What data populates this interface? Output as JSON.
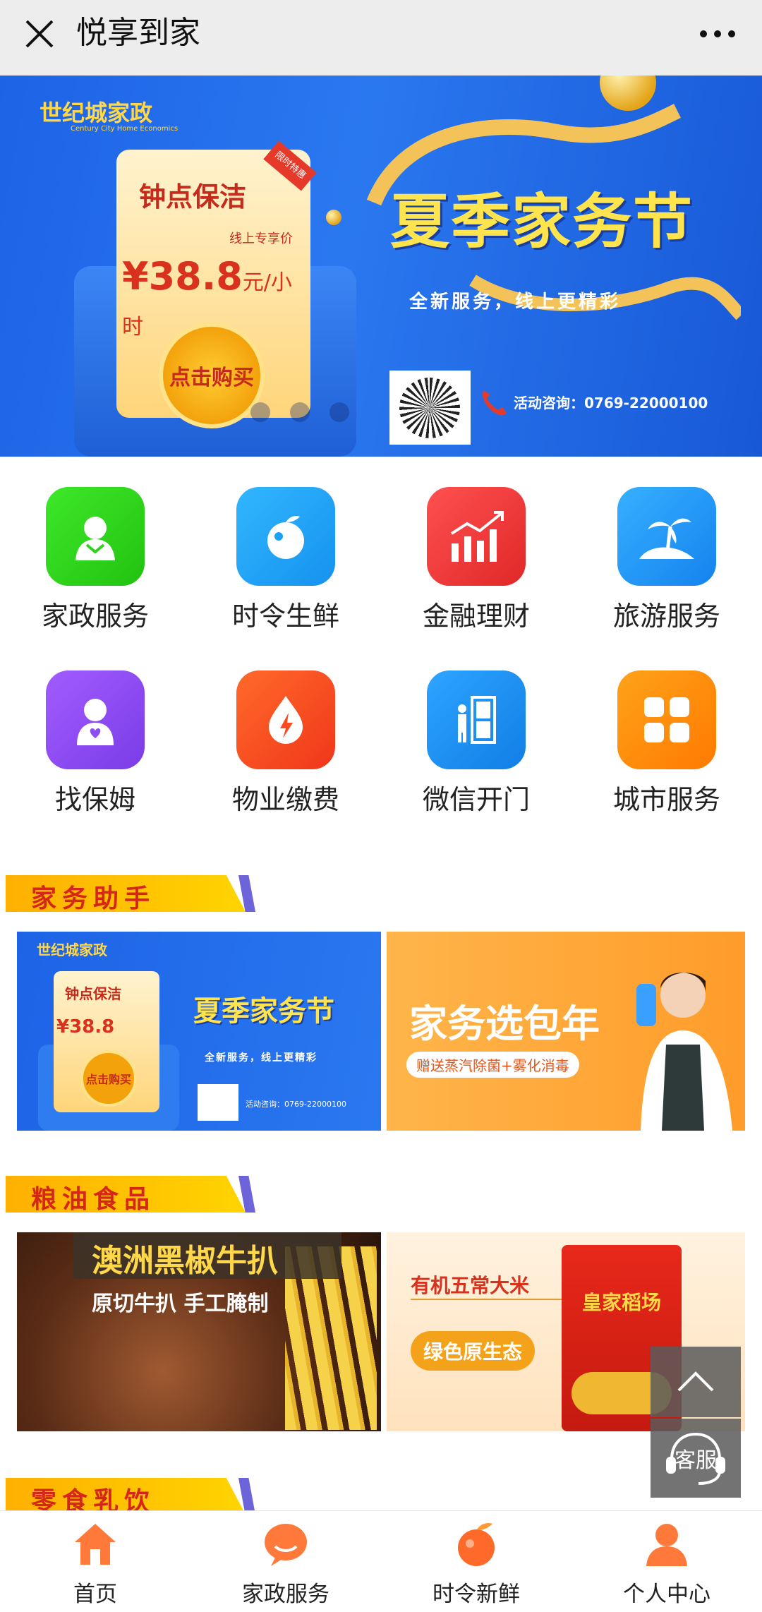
{
  "topbar": {
    "title": "悦享到家"
  },
  "banner": {
    "brand": "世纪城家政",
    "brand_sub": "Century City Home Economics",
    "card_tag": "限时特惠",
    "card_title": "钟点保洁",
    "card_subtitle": "线上专享价",
    "price": "¥38.8",
    "price_unit": "元/小时",
    "buy_label": "点击购买",
    "headline": "夏季家务节",
    "slogan": "全新服务，线上更精彩",
    "contact": "活动咨询：0769-22000100"
  },
  "menu": [
    {
      "label": "家政服务",
      "icon": "housekeeper-icon",
      "color": "#2fd31a"
    },
    {
      "label": "时令生鲜",
      "icon": "fruit-icon",
      "color": "#1aa3f5"
    },
    {
      "label": "金融理财",
      "icon": "chart-icon",
      "color": "#f03b3b"
    },
    {
      "label": "旅游服务",
      "icon": "palm-island-icon",
      "color": "#1c9bf2"
    },
    {
      "label": "找保姆",
      "icon": "nanny-icon",
      "color": "#8c4ff0"
    },
    {
      "label": "物业缴费",
      "icon": "flame-drop-icon",
      "color": "#ff4a1f"
    },
    {
      "label": "微信开门",
      "icon": "door-icon",
      "color": "#1690ee"
    },
    {
      "label": "城市服务",
      "icon": "grid-icon",
      "color": "#ff8a00"
    }
  ],
  "sections": {
    "housework": "家务助手",
    "grain": "粮油食品",
    "snacks": "零食乳饮"
  },
  "tiles": {
    "housework_right_title": "家务选包年",
    "housework_right_sub": "赠送蒸汽除菌+雾化消毒",
    "mini_contact": "活动咨询：0769-22000100",
    "steak_title": "澳洲黑椒牛扒",
    "steak_sub": "原切牛扒 手工腌制",
    "rice_title": "有机五常大米",
    "rice_sub": "绿色原生态",
    "rice_brand": "皇家稻场"
  },
  "float": {
    "service_label": "客服"
  },
  "bottom_nav": [
    {
      "label": "首页",
      "icon": "home-icon"
    },
    {
      "label": "家政服务",
      "icon": "chat-bubble-icon"
    },
    {
      "label": "时令新鲜",
      "icon": "peach-icon"
    },
    {
      "label": "个人中心",
      "icon": "person-icon"
    }
  ],
  "colors": {
    "accent_orange": "#ff7a1a",
    "banner_blue": "#2a78f0",
    "section_red": "#d6261a"
  }
}
